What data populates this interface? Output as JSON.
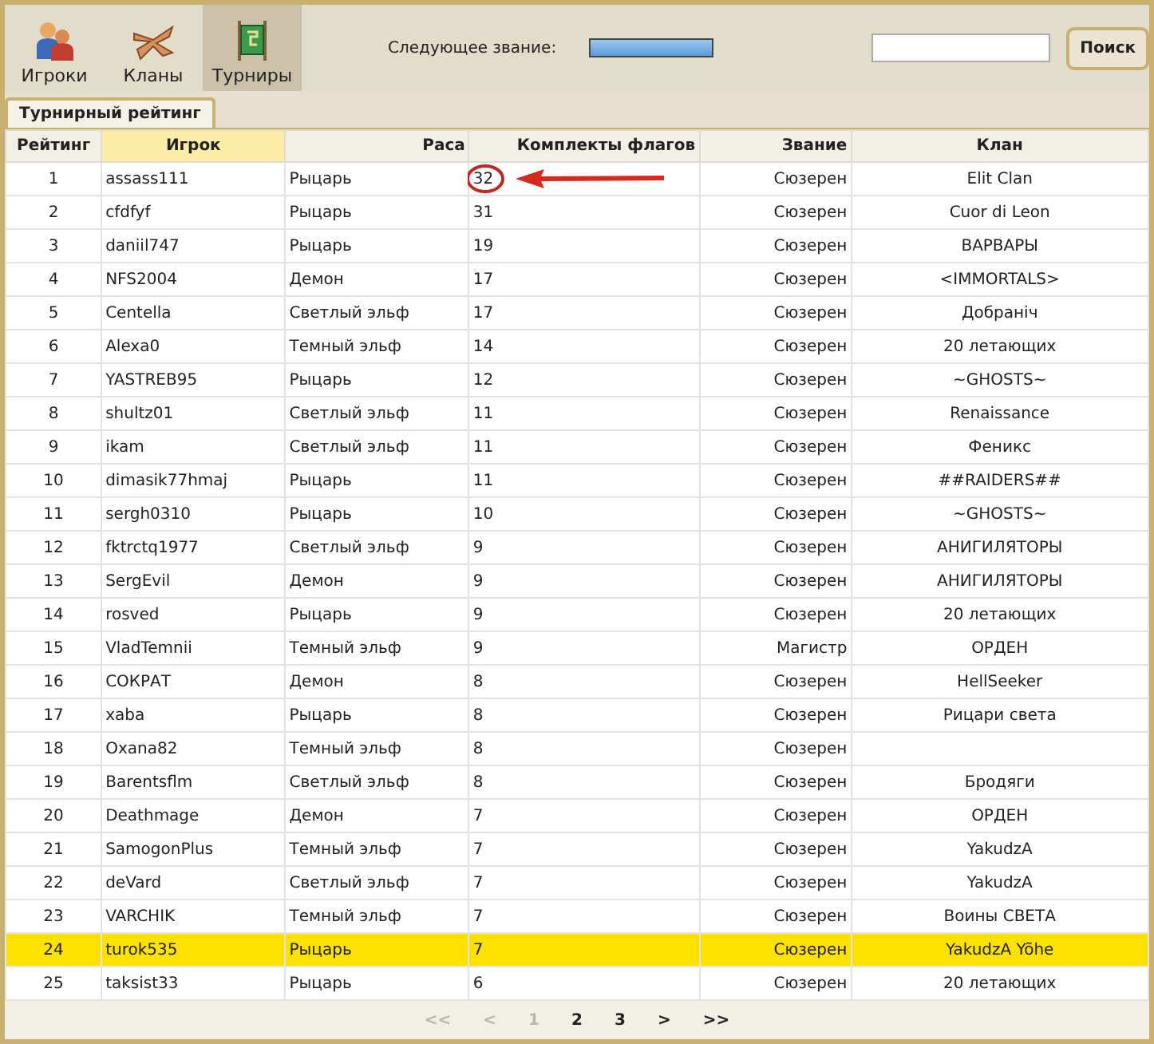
{
  "nav": [
    {
      "label": "Игроки",
      "kind": "players",
      "selected": false
    },
    {
      "label": "Кланы",
      "kind": "clans",
      "selected": false
    },
    {
      "label": "Турниры",
      "kind": "tournaments",
      "selected": true
    }
  ],
  "next_rank": {
    "label": "Следующее звание:",
    "level": 1
  },
  "search": {
    "button": "Поиск"
  },
  "tab": {
    "label": "Турнирный рейтинг"
  },
  "table": {
    "columns": [
      {
        "label": "Рейтинг",
        "sorted": false
      },
      {
        "label": "Игрок",
        "sorted": true
      },
      {
        "label": "Раса",
        "sorted": false
      },
      {
        "label": "Комплекты флагов",
        "sorted": false
      },
      {
        "label": "Звание",
        "sorted": false
      },
      {
        "label": "Клан",
        "sorted": false
      }
    ],
    "rows": [
      {
        "cells": [
          "1",
          "assass111",
          "Рыцарь",
          "32",
          "Сюзерен",
          "Elit Clan"
        ],
        "selected": false,
        "circled": true
      },
      {
        "cells": [
          "2",
          "cfdfyf",
          "Рыцарь",
          "31",
          "Сюзерен",
          "Cuor di Leon"
        ],
        "selected": false,
        "circled": false
      },
      {
        "cells": [
          "3",
          "daniil747",
          "Рыцарь",
          "19",
          "Сюзерен",
          "ВАРВАРЫ"
        ],
        "selected": false,
        "circled": false
      },
      {
        "cells": [
          "4",
          "NFS2004",
          "Демон",
          "17",
          "Сюзерен",
          "<IMMORTALS>"
        ],
        "selected": false,
        "circled": false
      },
      {
        "cells": [
          "5",
          "Centella",
          "Светлый эльф",
          "17",
          "Сюзерен",
          "Добраніч"
        ],
        "selected": false,
        "circled": false
      },
      {
        "cells": [
          "6",
          "Alexa0",
          "Темный эльф",
          "14",
          "Сюзерен",
          "20 летающих"
        ],
        "selected": false,
        "circled": false
      },
      {
        "cells": [
          "7",
          "YASTREB95",
          "Рыцарь",
          "12",
          "Сюзерен",
          "~GHOSTS~"
        ],
        "selected": false,
        "circled": false
      },
      {
        "cells": [
          "8",
          "shultz01",
          "Светлый эльф",
          "11",
          "Сюзерен",
          "Renaissance"
        ],
        "selected": false,
        "circled": false
      },
      {
        "cells": [
          "9",
          "ikam",
          "Светлый эльф",
          "11",
          "Сюзерен",
          "Феникс"
        ],
        "selected": false,
        "circled": false
      },
      {
        "cells": [
          "10",
          "dimasik77hmaj",
          "Рыцарь",
          "11",
          "Сюзерен",
          "##RAIDERS##"
        ],
        "selected": false,
        "circled": false
      },
      {
        "cells": [
          "11",
          "sergh0310",
          "Рыцарь",
          "10",
          "Сюзерен",
          "~GHOSTS~"
        ],
        "selected": false,
        "circled": false
      },
      {
        "cells": [
          "12",
          "fktrctq1977",
          "Светлый эльф",
          "9",
          "Сюзерен",
          "АНИГИЛЯТОРЫ"
        ],
        "selected": false,
        "circled": false
      },
      {
        "cells": [
          "13",
          "SergEvil",
          "Демон",
          "9",
          "Сюзерен",
          "АНИГИЛЯТОРЫ"
        ],
        "selected": false,
        "circled": false
      },
      {
        "cells": [
          "14",
          "rosved",
          "Рыцарь",
          "9",
          "Сюзерен",
          "20 летающих"
        ],
        "selected": false,
        "circled": false
      },
      {
        "cells": [
          "15",
          "VladTemnii",
          "Темный эльф",
          "9",
          "Магистр",
          "ОРДЕН"
        ],
        "selected": false,
        "circled": false
      },
      {
        "cells": [
          "16",
          "СОКРАТ",
          "Демон",
          "8",
          "Сюзерен",
          "HellSeeker"
        ],
        "selected": false,
        "circled": false
      },
      {
        "cells": [
          "17",
          "xaba",
          "Рыцарь",
          "8",
          "Сюзерен",
          "Рицари света"
        ],
        "selected": false,
        "circled": false
      },
      {
        "cells": [
          "18",
          "Oxana82",
          "Темный эльф",
          "8",
          "Сюзерен",
          ""
        ],
        "selected": false,
        "circled": false
      },
      {
        "cells": [
          "19",
          "Barentsflm",
          "Светлый эльф",
          "8",
          "Сюзерен",
          "Бродяги"
        ],
        "selected": false,
        "circled": false
      },
      {
        "cells": [
          "20",
          "Deathmage",
          "Демон",
          "7",
          "Сюзерен",
          "ОРДЕН"
        ],
        "selected": false,
        "circled": false
      },
      {
        "cells": [
          "21",
          "SamogonPlus",
          "Темный эльф",
          "7",
          "Сюзерен",
          "YakudzA"
        ],
        "selected": false,
        "circled": false
      },
      {
        "cells": [
          "22",
          "deVard",
          "Светлый эльф",
          "7",
          "Сюзерен",
          "YakudzA"
        ],
        "selected": false,
        "circled": false
      },
      {
        "cells": [
          "23",
          "VARCHIK",
          "Темный эльф",
          "7",
          "Сюзерен",
          "Воины СВЕТА"
        ],
        "selected": false,
        "circled": false
      },
      {
        "cells": [
          "24",
          "turok535",
          "Рыцарь",
          "7",
          "Сюзерен",
          "YakudzA Yõhe"
        ],
        "selected": true,
        "circled": false
      },
      {
        "cells": [
          "25",
          "taksist33",
          "Рыцарь",
          "6",
          "Сюзерен",
          "20 летающих"
        ],
        "selected": false,
        "circled": false
      }
    ]
  },
  "pagination": [
    {
      "label": "<<",
      "disabled": true
    },
    {
      "label": "<",
      "disabled": true
    },
    {
      "label": "1",
      "disabled": true
    },
    {
      "label": "2",
      "disabled": false
    },
    {
      "label": "3",
      "disabled": false
    },
    {
      "label": ">",
      "disabled": false
    },
    {
      "label": ">>",
      "disabled": false
    }
  ]
}
